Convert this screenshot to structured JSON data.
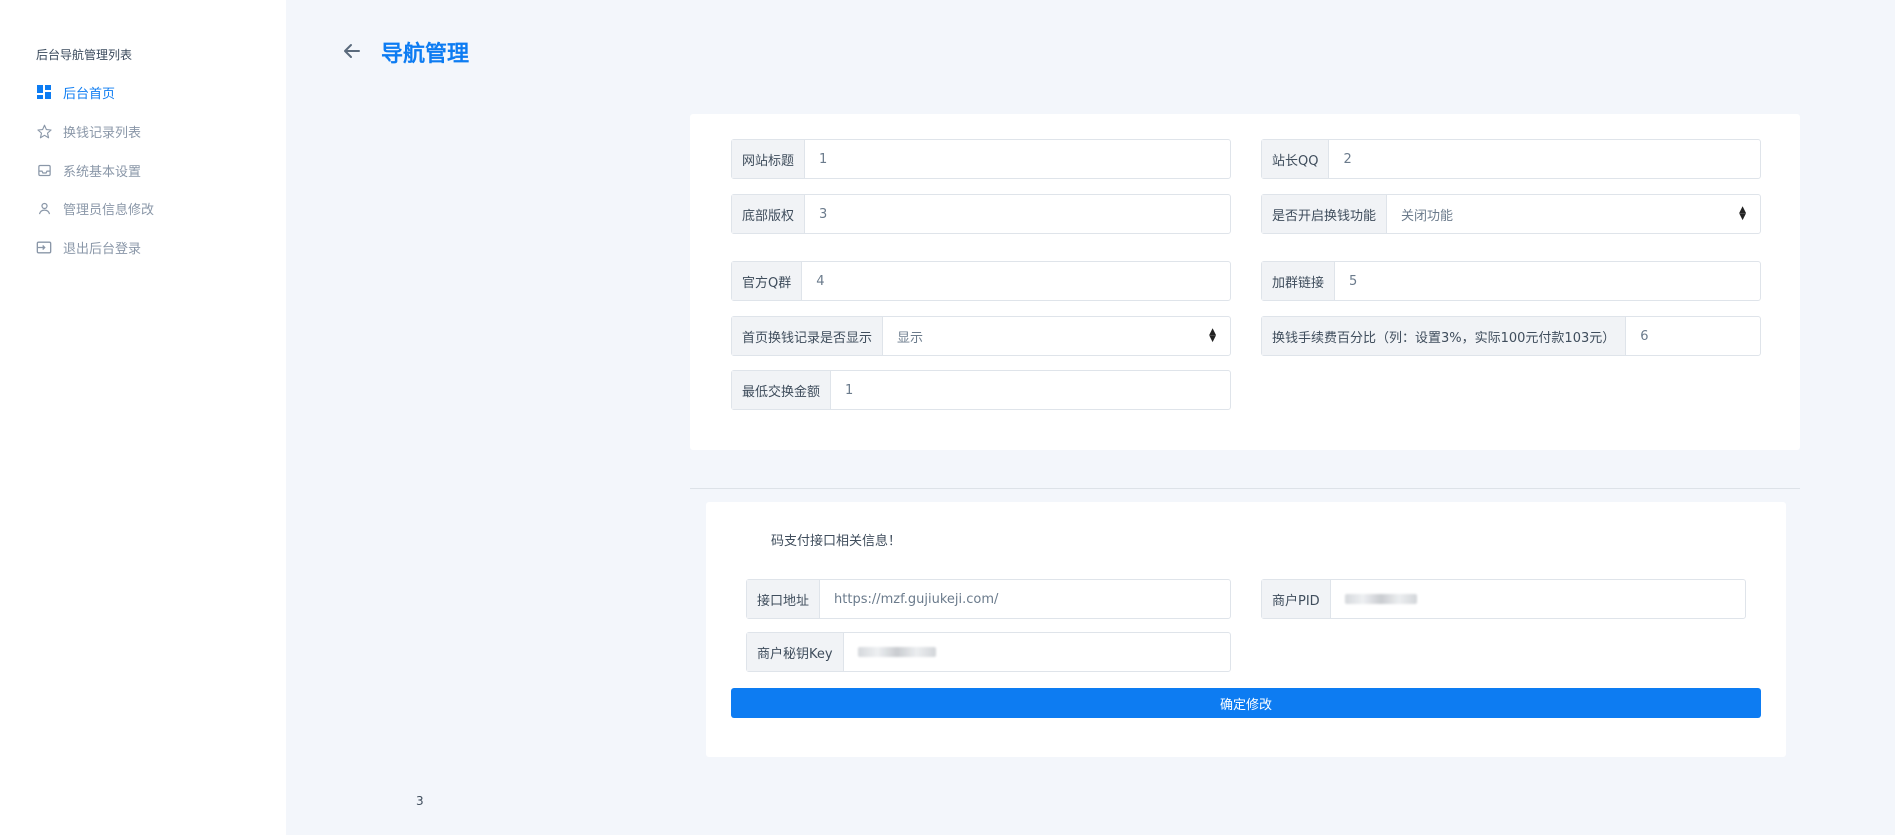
{
  "sidebar": {
    "title": "后台导航管理列表",
    "items": [
      {
        "label": "后台首页",
        "icon": "dashboard-icon"
      },
      {
        "label": "换钱记录列表",
        "icon": "star-icon"
      },
      {
        "label": "系统基本设置",
        "icon": "inbox-icon"
      },
      {
        "label": "管理员信息修改",
        "icon": "user-icon"
      },
      {
        "label": "退出后台登录",
        "icon": "logout-icon"
      }
    ]
  },
  "header": {
    "title": "导航管理"
  },
  "form": {
    "site_title": {
      "label": "网站标题",
      "value": "1"
    },
    "webmaster_qq": {
      "label": "站长QQ",
      "value": "2"
    },
    "footer_copyright": {
      "label": "底部版权",
      "value": "3"
    },
    "enable_exchange": {
      "label": "是否开启换钱功能",
      "selected": "关闭功能"
    },
    "official_group": {
      "label": "官方Q群",
      "value": "4"
    },
    "group_link": {
      "label": "加群链接",
      "value": "5"
    },
    "show_records": {
      "label": "首页换钱记录是否显示",
      "selected": "显示"
    },
    "fee_percent": {
      "label": "换钱手续费百分比（列：设置3%，实际100元付款103元）",
      "value": "6"
    },
    "min_amount": {
      "label": "最低交换金额",
      "value": "1"
    }
  },
  "payment": {
    "notice": "码支付接口相关信息！",
    "api_url": {
      "label": "接口地址",
      "value": "https://mzf.gujiukeji.com/"
    },
    "merchant_pid": {
      "label": "商户PID"
    },
    "merchant_key": {
      "label": "商户秘钥Key"
    }
  },
  "submit_label": "确定修改",
  "footer_number": "3",
  "colors": {
    "accent": "#0d7cf2",
    "background": "#f3f6fb"
  }
}
